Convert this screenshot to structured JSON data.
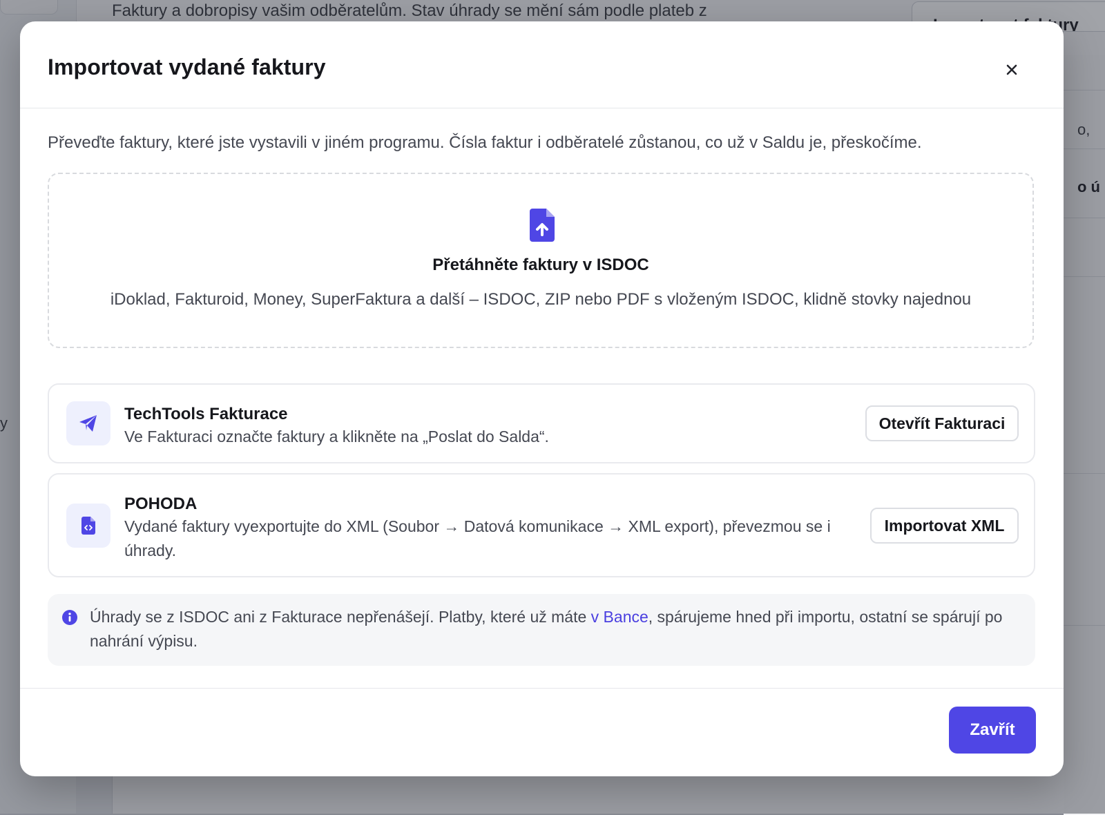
{
  "background": {
    "subtitle": "Faktury a dobropisy vašim odběratelům. Stav úhrady se mění sám podle plateb z",
    "top_button_label": "Importovat faktury",
    "right_fragment_1": "o,",
    "right_fragment_2": "o ú",
    "left_fragment": "y"
  },
  "modal": {
    "title": "Importovat vydané faktury",
    "intro": "Převeďte faktury, které jste vystavili v jiném programu. Čísla faktur i odběratelé zůstanou, co už v Saldu je, přeskočíme.",
    "dropzone": {
      "icon": "file-upload-icon",
      "title": "Přetáhněte faktury v ISDOC",
      "subtitle": "iDoklad, Fakturoid, Money, SuperFaktura a další – ISDOC, ZIP nebo PDF s vloženým ISDOC, klidně stovky najednou"
    },
    "sources": [
      {
        "icon": "paper-plane-icon",
        "title": "TechTools Fakturace",
        "description": "Ve Fakturaci označte faktury a klikněte na „Poslat do Salda“.",
        "button": "Otevřít Fakturaci"
      },
      {
        "icon": "code-file-icon",
        "title": "POHODA",
        "description": "Vydané faktury vyexportujte do XML (Soubor → Datová komunikace → XML export), převezmou se i úhrady.",
        "button": "Importovat XML"
      }
    ],
    "info": {
      "icon": "info-icon",
      "text_before": "Úhrady se z ISDOC ani z Fakturace nepřenášejí. Platby, které už máte ",
      "link": "v Bance",
      "text_after": ", spárujeme hned při importu, ostatní se spárují po nahrání výpisu."
    },
    "close_label": "Zavřít"
  },
  "colors": {
    "accent": "#4f46e5",
    "icon_bg": "#eef0fd",
    "info_bg": "#f5f6f8"
  }
}
